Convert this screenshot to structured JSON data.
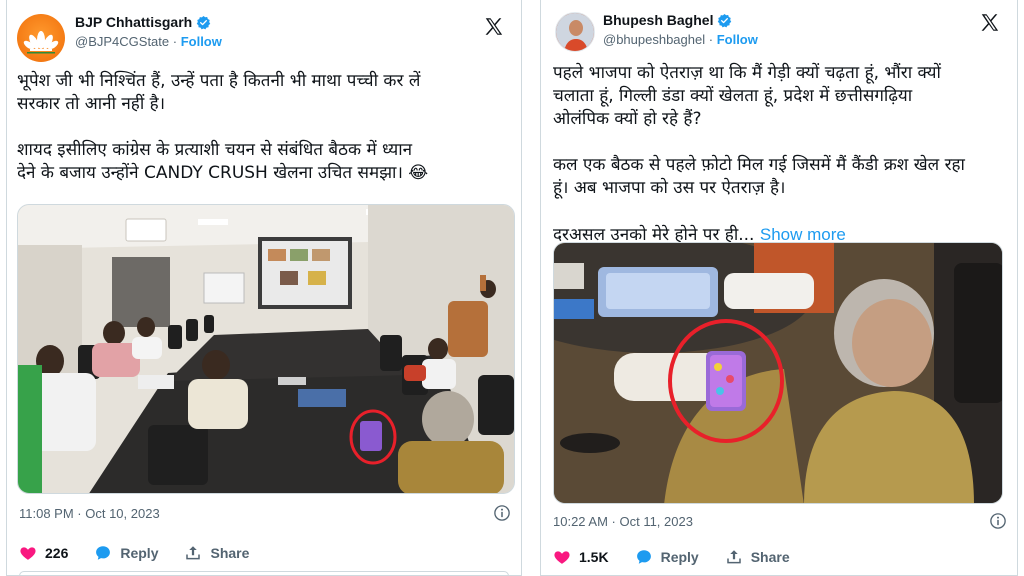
{
  "left_tweet": {
    "display_name": "BJP Chhattisgarh",
    "handle": "@BJP4CGState",
    "follow_label": "Follow",
    "text": "भूपेश जी भी निश्चिंत हैं, उन्हें पता है कितनी भी माथा पच्ची कर लें\nसरकार तो आनी नहीं है।\n\nशायद इसीलिए कांग्रेस के प्रत्याशी चयन से संबंधित बैठक में ध्यान\nदेने के बजाय उन्होंने CANDY CRUSH खेलना उचित समझा। 😂",
    "timestamp": "11:08 PM · Oct 10, 2023",
    "likes": "226",
    "reply_label": "Reply",
    "share_label": "Share"
  },
  "right_tweet": {
    "display_name": "Bhupesh Baghel",
    "handle": "@bhupeshbaghel",
    "follow_label": "Follow",
    "text": "पहले भाजपा को ऐतराज़ था कि मैं गेड़ी क्यों चढ़ता हूं, भौंरा क्यों\nचलाता हूं, गिल्ली डंडा क्यों खेलता हूं, प्रदेश में छत्तीसगढ़िया\nओलंपिक क्यों हो रहे हैं?\n\nकल एक बैठक से पहले फ़ोटो मिल गई जिसमें मैं कैंडी क्रश खेल रहा\nहूं। अब भाजपा को उस पर ऐतराज़ है।\n\nदरअसल उनको मेरे होने पर ही...",
    "show_more_label": "Show more",
    "timestamp": "10:22 AM · Oct 11, 2023",
    "likes": "1.5K",
    "reply_label": "Reply",
    "share_label": "Share"
  },
  "icons": {
    "verified": "verified-badge-icon",
    "x_logo": "x-logo-icon",
    "info": "info-icon",
    "like": "heart-icon",
    "reply": "reply-bubble-icon",
    "share": "share-upload-icon"
  },
  "colors": {
    "like_red": "#f91880",
    "reply_blue": "#1d9bf0",
    "follow_blue": "#1d9bf0",
    "verified_blue": "#1d9bf0",
    "highlight_circle": "#e8202a"
  }
}
